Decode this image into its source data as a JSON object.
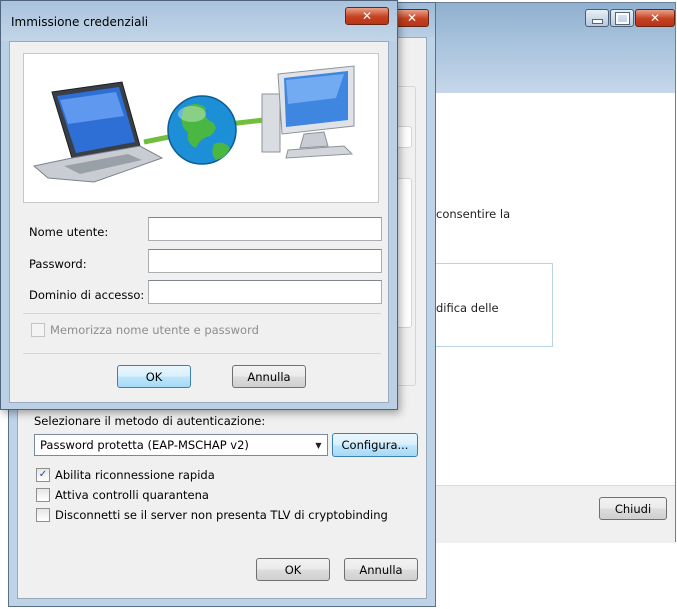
{
  "credentials_dialog": {
    "title": "Immissione credenziali",
    "close_label": "x",
    "fields": [
      {
        "label": "Nome utente:",
        "value": ""
      },
      {
        "label": "Password:",
        "value": ""
      },
      {
        "label": "Dominio di accesso:",
        "value": ""
      }
    ],
    "remember_label": "Memorizza nome utente e password",
    "remember_checked": false,
    "ok_label": "OK",
    "cancel_label": "Annulla"
  },
  "eap_dialog": {
    "close_label": "x",
    "auth_method_label": "Selezionare il metodo di autenticazione:",
    "auth_method_value": "Password protetta (EAP-MSCHAP v2)",
    "configure_label": "Configura...",
    "options": [
      {
        "label": "Abilita riconnessione rapida",
        "checked": true
      },
      {
        "label": "Attiva controlli quarantena",
        "checked": false
      },
      {
        "label": "Disconnetti se il server non presenta TLV di cryptobinding",
        "checked": false
      }
    ],
    "ok_label": "OK",
    "cancel_label": "Annulla"
  },
  "back_window": {
    "partial_text_1": "consentire la",
    "partial_text_2": "difica delle",
    "close_button_label": "Chiudi"
  },
  "colors": {
    "titlebar": "#b9cfe4",
    "close_red": "#c5411f",
    "focus_blue": "#3c7fb1"
  }
}
